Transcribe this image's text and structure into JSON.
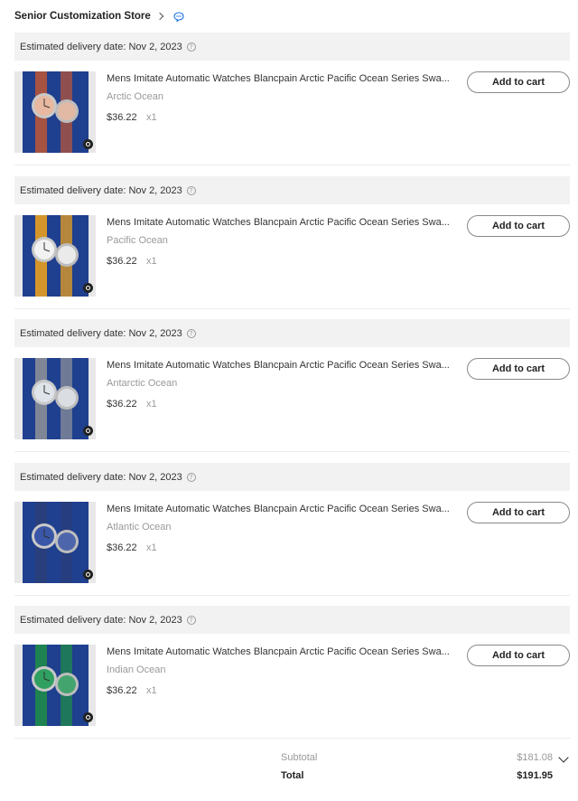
{
  "store": {
    "name": "Senior Customization Store"
  },
  "orders": [
    {
      "delivery": "Estimated delivery date: Nov 2, 2023",
      "title": "Mens Imitate Automatic Watches Blancpain Arctic Pacific Ocean Series Swa...",
      "variant": "Arctic Ocean",
      "price": "$36.22",
      "qty": "x1",
      "button": "Add to cart",
      "strap": "#b5553a",
      "dial": "#e8b8a0"
    },
    {
      "delivery": "Estimated delivery date: Nov 2, 2023",
      "title": "Mens Imitate Automatic Watches Blancpain Arctic Pacific Ocean Series Swa...",
      "variant": "Pacific Ocean",
      "price": "$36.22",
      "qty": "x1",
      "button": "Add to cart",
      "strap": "#e8a020",
      "dial": "#f2f2f2"
    },
    {
      "delivery": "Estimated delivery date: Nov 2, 2023",
      "title": "Mens Imitate Automatic Watches Blancpain Arctic Pacific Ocean Series Swa...",
      "variant": "Antarctic Ocean",
      "price": "$36.22",
      "qty": "x1",
      "button": "Add to cart",
      "strap": "#8a8f98",
      "dial": "#dfe4ea"
    },
    {
      "delivery": "Estimated delivery date: Nov 2, 2023",
      "title": "Mens Imitate Automatic Watches Blancpain Arctic Pacific Ocean Series Swa...",
      "variant": "Atlantic Ocean",
      "price": "$36.22",
      "qty": "x1",
      "button": "Add to cart",
      "strap": "#2a3f7a",
      "dial": "#3a56a8"
    },
    {
      "delivery": "Estimated delivery date: Nov 2, 2023",
      "title": "Mens Imitate Automatic Watches Blancpain Arctic Pacific Ocean Series Swa...",
      "variant": "Indian Ocean",
      "price": "$36.22",
      "qty": "x1",
      "button": "Add to cart",
      "strap": "#1f8a4a",
      "dial": "#2fa060"
    }
  ],
  "summary": {
    "subtotal_label": "Subtotal",
    "subtotal_value": "$181.08",
    "total_label": "Total",
    "total_value": "$191.95"
  },
  "colors": {
    "background": "#ffffff",
    "delivery_bar": "#f2f2f2",
    "photo_bg": "#1f3f8f",
    "link_blue": "#1a73e8"
  }
}
